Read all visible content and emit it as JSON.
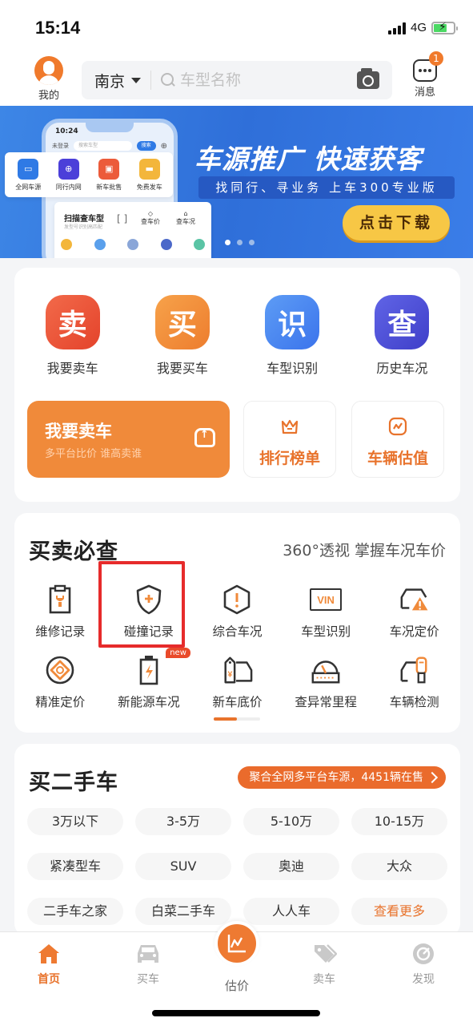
{
  "status_bar": {
    "time": "15:14",
    "network": "4G"
  },
  "header": {
    "profile_label": "我的",
    "city": "南京",
    "search_placeholder": "车型名称",
    "messages_label": "消息",
    "messages_badge": "1"
  },
  "banner": {
    "title": "车源推广 快速获客",
    "subtitle": "找同行、寻业务  上车300专业版",
    "cta": "点击下载",
    "page_count": 3,
    "active_page": 1,
    "mock_phone": {
      "time": "10:24",
      "login": "未登录",
      "search_placeholder": "搜索车型",
      "search_button": "搜索",
      "quick_items": [
        "全网车源",
        "同行内网",
        "新车批售",
        "免费发车"
      ],
      "scan_title": "扫描查车型",
      "scan_subtitle": "发型号识别高匹配",
      "check_price": "查车价",
      "check_condition": "查车况"
    }
  },
  "quick_actions": [
    {
      "glyph": "卖",
      "label": "我要卖车",
      "color": "#ea5138"
    },
    {
      "glyph": "买",
      "label": "我要买车",
      "color": "#f0893a"
    },
    {
      "glyph": "识",
      "label": "车型识别",
      "color": "#3d7df0"
    },
    {
      "glyph": "查",
      "label": "历史车况",
      "color": "#4a4fd8"
    }
  ],
  "sell_card": {
    "title": "我要卖车",
    "subtitle": "多平台比价 谁高卖谁"
  },
  "mini_cards": [
    {
      "label": "排行榜单",
      "icon": "crown-icon"
    },
    {
      "label": "车辆估值",
      "icon": "trend-icon"
    }
  ],
  "must_check": {
    "title": "买卖必查",
    "subtitle": "360°透视 掌握车况车价",
    "row1": [
      {
        "label": "维修记录",
        "icon": "clipboard-wrench-icon"
      },
      {
        "label": "碰撞记录",
        "icon": "shield-plus-icon",
        "highlighted": true
      },
      {
        "label": "综合车况",
        "icon": "hexagon-alert-icon"
      },
      {
        "label": "车型识别",
        "icon": "vin-icon",
        "vin_text": "VIN"
      },
      {
        "label": "车况定价",
        "icon": "car-warning-icon"
      }
    ],
    "row2": [
      {
        "label": "精准定价",
        "icon": "target-icon"
      },
      {
        "label": "新能源车况",
        "icon": "battery-bolt-icon",
        "tag": "new"
      },
      {
        "label": "新车底价",
        "icon": "price-tag-truck-icon"
      },
      {
        "label": "查异常里程",
        "icon": "odometer-icon"
      },
      {
        "label": "车辆检测",
        "icon": "car-scanner-icon"
      }
    ],
    "page_progress": 0.5
  },
  "used_cars": {
    "title": "买二手车",
    "promo": "聚合全网多平台车源，4451辆在售",
    "tags": [
      "3万以下",
      "3-5万",
      "5-10万",
      "10-15万",
      "紧凑型车",
      "SUV",
      "奥迪",
      "大众",
      "二手车之家",
      "白菜二手车",
      "人人车",
      "查看更多"
    ]
  },
  "tab_bar": [
    {
      "label": "首页",
      "icon": "home-icon",
      "active": true
    },
    {
      "label": "买车",
      "icon": "car-icon",
      "active": false
    },
    {
      "label": "估价",
      "icon": "chart-icon",
      "active": false
    },
    {
      "label": "卖车",
      "icon": "tag-icon",
      "active": false
    },
    {
      "label": "发现",
      "icon": "compass-icon",
      "active": false
    }
  ],
  "colors": {
    "accent": "#ee7a32",
    "highlight_box": "#e62b2b",
    "banner_blue": "#2f6fd9",
    "cta_yellow": "#f7c745"
  }
}
